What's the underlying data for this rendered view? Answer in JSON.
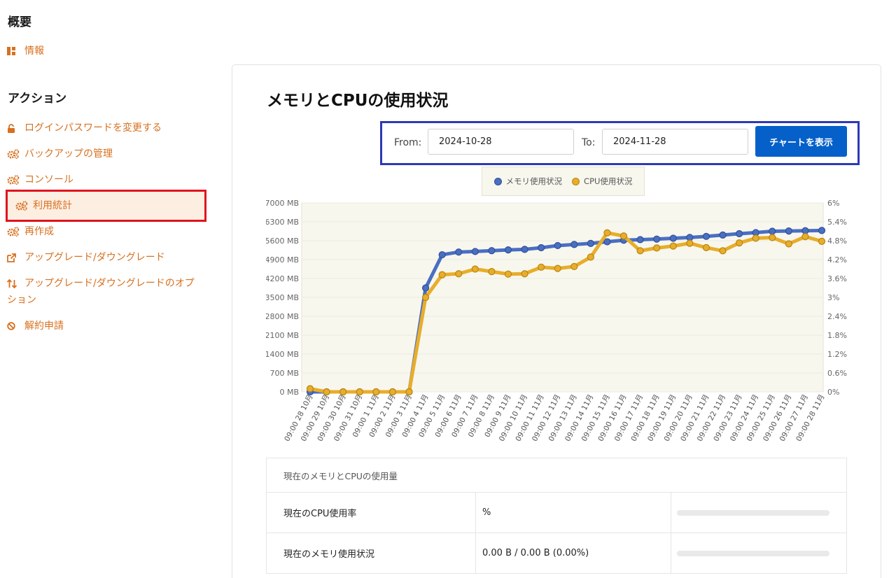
{
  "sidebar": {
    "overview_title": "概要",
    "info": "情報",
    "actions_title": "アクション",
    "items": [
      {
        "label": "ログインパスワードを変更する",
        "icon": "lock-icon"
      },
      {
        "label": "バックアップの管理",
        "icon": "gears-icon"
      },
      {
        "label": "コンソール",
        "icon": "gears-icon"
      },
      {
        "label": "利用統計",
        "icon": "gears-icon",
        "active": true
      },
      {
        "label": "再作成",
        "icon": "gears-icon"
      },
      {
        "label": "アップグレード/ダウングレード",
        "icon": "external-link-icon"
      },
      {
        "label": "アップグレード/ダウングレードのオプ",
        "label2": "ション",
        "icon": "sort-icon"
      },
      {
        "label": "解約申請",
        "icon": "ban-icon"
      }
    ]
  },
  "main": {
    "title": "メモリとCPUの使用状況",
    "from_label": "From:",
    "from_value": "2024-10-28",
    "to_label": "To:",
    "to_value": "2024-11-28",
    "show_button": "チャートを表示"
  },
  "chart_data": {
    "type": "line",
    "series": [
      {
        "name": "メモリ使用状況",
        "color": "#4a6fc1",
        "axis": "left",
        "values": [
          0,
          0,
          0,
          0,
          0,
          0,
          0,
          3850,
          5080,
          5180,
          5200,
          5230,
          5260,
          5280,
          5340,
          5420,
          5460,
          5500,
          5560,
          5620,
          5640,
          5660,
          5690,
          5720,
          5760,
          5810,
          5860,
          5900,
          5950,
          5960,
          5970,
          5980
        ]
      },
      {
        "name": "CPU使用状況",
        "color": "#e8ad2a",
        "axis": "right",
        "values": [
          0.1,
          0,
          0,
          0,
          0,
          0,
          0,
          3.0,
          3.72,
          3.75,
          3.9,
          3.82,
          3.74,
          3.75,
          3.96,
          3.92,
          3.98,
          4.28,
          5.05,
          4.95,
          4.48,
          4.57,
          4.63,
          4.72,
          4.58,
          4.48,
          4.73,
          4.88,
          4.9,
          4.7,
          4.93,
          4.78
        ]
      }
    ],
    "categories": [
      "09:00 28 10月",
      "09:00 29 10月",
      "09:00 30 10月",
      "09:00 31 10月",
      "09:00 1 11月",
      "09:00 2 11月",
      "09:00 3 11月",
      "09:00 4 11月",
      "09:00 5 11月",
      "09:00 6 11月",
      "09:00 7 11月",
      "09:00 8 11月",
      "09:00 9 11月",
      "09:00 10 11月",
      "09:00 11 11月",
      "09:00 12 11月",
      "09:00 13 11月",
      "09:00 14 11月",
      "09:00 15 11月",
      "09:00 16 11月",
      "09:00 17 11月",
      "09:00 18 11月",
      "09:00 19 11月",
      "09:00 20 11月",
      "09:00 21 11月",
      "09:00 22 11月",
      "09:00 23 11月",
      "09:00 24 11月",
      "09:00 25 11月",
      "09:00 26 11月",
      "09:00 27 11月",
      "09:00 28 11月"
    ],
    "y_left_ticks": [
      "0 MB",
      "700 MB",
      "1400 MB",
      "2100 MB",
      "2800 MB",
      "3500 MB",
      "4200 MB",
      "4900 MB",
      "5600 MB",
      "6300 MB",
      "7000 MB"
    ],
    "y_right_ticks": [
      "0%",
      "0.6%",
      "1.2%",
      "1.8%",
      "2.4%",
      "3%",
      "3.6%",
      "4.2%",
      "4.8%",
      "5.4%",
      "6%"
    ],
    "ylim_left": [
      0,
      7000
    ],
    "ylim_right": [
      0,
      6
    ],
    "legend_position": "top-center",
    "plot_background": "#f8f7ee"
  },
  "usage": {
    "header": "現在のメモリとCPUの使用量",
    "rows": [
      {
        "label": "現在のCPU使用率",
        "value": "%",
        "percent": 0
      },
      {
        "label": "現在のメモリ使用状況",
        "value": "0.00 B / 0.00 B (0.00%)",
        "percent": 0
      }
    ]
  }
}
